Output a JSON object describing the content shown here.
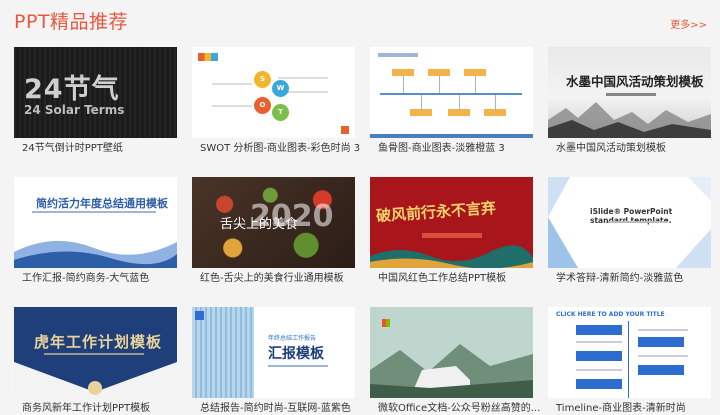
{
  "header": {
    "title": "PPT精品推荐",
    "more_label": "更多>>"
  },
  "colors": {
    "accent": "#e8573e",
    "card_caption": "#333333"
  },
  "cards": [
    {
      "caption": "24节气倒计时PPT壁纸",
      "thumb_text": "24节气",
      "thumb_sub": "24 Solar Terms"
    },
    {
      "caption": "SWOT 分析图-商业图表-彩色时尚 3",
      "thumb_letters": [
        "S",
        "W",
        "O",
        "T"
      ]
    },
    {
      "caption": "鱼骨图-商业图表-淡雅橙蓝 3"
    },
    {
      "caption": "水墨中国风活动策划模板",
      "thumb_text": "水墨中国风活动策划模板"
    },
    {
      "caption": "工作汇报-简约商务-大气蓝色",
      "thumb_text": "简约活力年度总结通用模板"
    },
    {
      "caption": "红色-舌尖上的美食行业通用模板",
      "thumb_text": "舌尖上的美食",
      "thumb_year": "2020"
    },
    {
      "caption": "中国风红色工作总结PPT模板",
      "thumb_text": "破风前行永不言弃"
    },
    {
      "caption": "学术答辩-清新简约-淡雅蓝色",
      "thumb_text": "iSlide® PowerPoint standard template."
    },
    {
      "caption": "商务风新年工作计划PPT模板",
      "thumb_text": "虎年工作计划模板"
    },
    {
      "caption": "总结报告-简约时尚-互联网-蓝紫色",
      "thumb_small": "年终总结工作报告",
      "thumb_text": "汇报模板"
    },
    {
      "caption": "微软Office文档-公众号粉丝高赞的...",
      "thumb_text": "Microsoft"
    },
    {
      "caption": "Timeline-商业图表-清新时尚",
      "thumb_text": "CLICK HERE TO ADD YOUR TITLE"
    }
  ]
}
